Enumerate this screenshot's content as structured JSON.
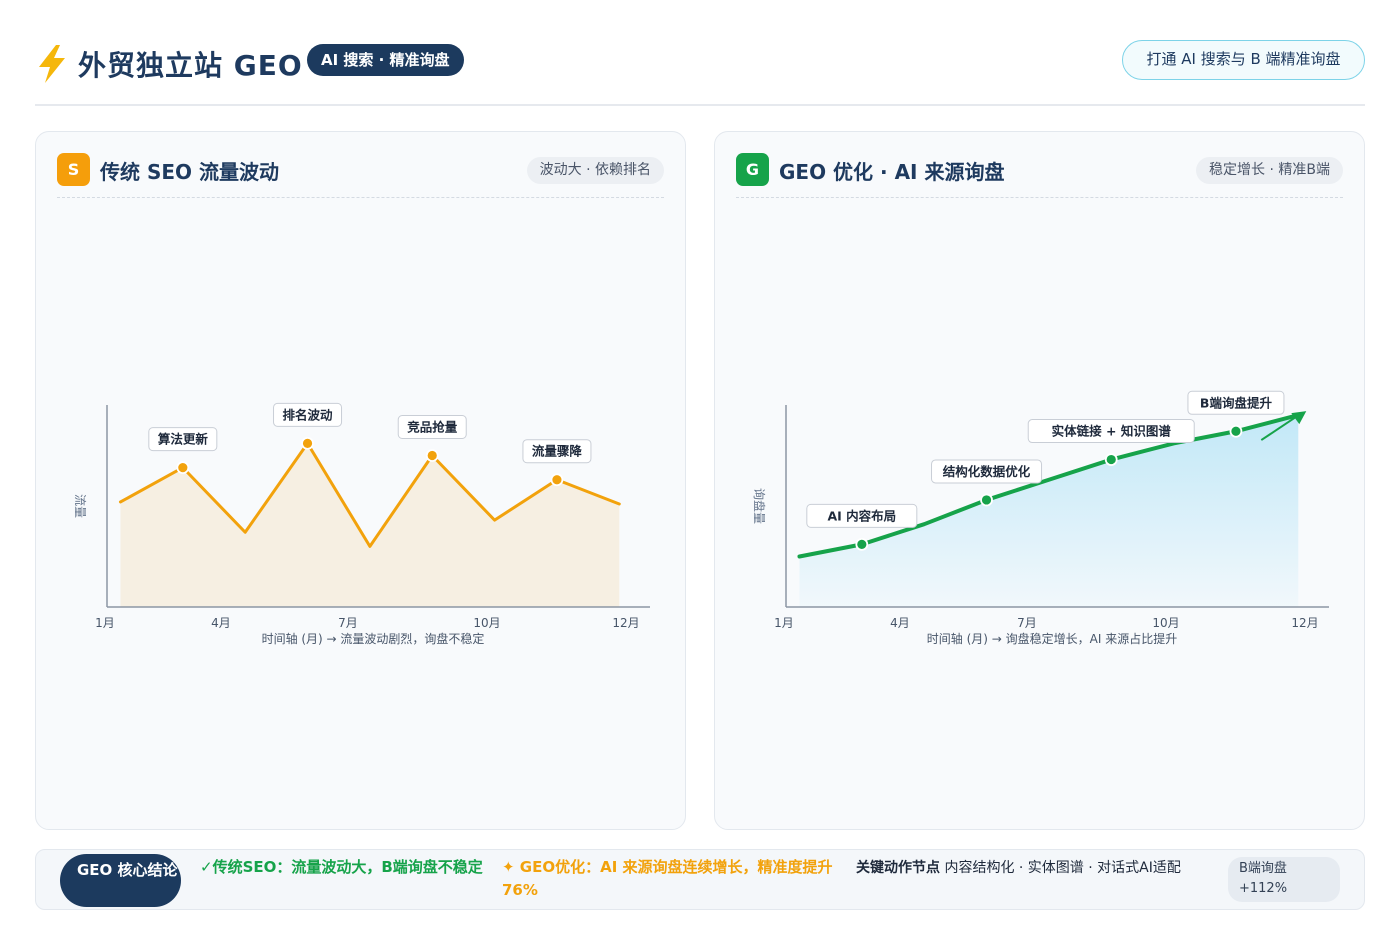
{
  "header": {
    "icon": "lightning-icon",
    "title": "外贸独立站 GEO",
    "badge": "AI 搜索 · 精准询盘",
    "cta": "打通 AI 搜索与 B 端精准询盘"
  },
  "panels": {
    "left": {
      "icon_letter": "S",
      "title": "传统 SEO 流量波动",
      "tag": "波动大 · 依赖排名",
      "color": "#f59e0b"
    },
    "right": {
      "icon_letter": "G",
      "title": "GEO 优化 · AI 来源询盘",
      "tag": "稳定增长 · 精准B端",
      "color": "#16a34a"
    }
  },
  "chart_data": [
    {
      "type": "area",
      "ylabel": "流量",
      "xlabel": "时间轴 (月) → 流量波动剧烈，询盘不稳定",
      "x_ticks": [
        "1月",
        "4月",
        "7月",
        "10月",
        "12月"
      ],
      "series": [
        {
          "x": [
            1,
            3,
            5,
            7,
            9,
            11,
            13,
            15,
            17
          ],
          "values": [
            0.52,
            0.69,
            0.37,
            0.81,
            0.3,
            0.75,
            0.43,
            0.63,
            0.51
          ]
        }
      ],
      "annotations": [
        {
          "x": 3,
          "y": 0.69,
          "text": "算法更新"
        },
        {
          "x": 7,
          "y": 0.81,
          "text": "排名波动"
        },
        {
          "x": 11,
          "y": 0.75,
          "text": "竞品抢量"
        },
        {
          "x": 15,
          "y": 0.63,
          "text": "流量骤降"
        }
      ],
      "xlim": [
        0.6,
        17.6
      ],
      "ylim": [
        0,
        1
      ],
      "grid": false,
      "color": "#f2a20c",
      "fill": "#f6efe2"
    },
    {
      "type": "area",
      "ylabel": "询盘量",
      "xlabel": "时间轴 (月) → 询盘稳定增长，AI 来源占比提升",
      "x_ticks": [
        "1月",
        "4月",
        "7月",
        "10月",
        "12月"
      ],
      "series": [
        {
          "x": [
            1,
            3,
            5,
            7,
            9,
            11,
            13,
            15,
            17
          ],
          "values": [
            0.25,
            0.31,
            0.41,
            0.53,
            0.63,
            0.73,
            0.81,
            0.87,
            0.95
          ]
        }
      ],
      "annotations": [
        {
          "x": 3,
          "y": 0.31,
          "text": "AI 内容布局"
        },
        {
          "x": 7,
          "y": 0.53,
          "text": "结构化数据优化"
        },
        {
          "x": 11,
          "y": 0.73,
          "text": "实体链接 + 知识图谱"
        },
        {
          "x": 15,
          "y": 0.87,
          "text": "B端询盘提升"
        }
      ],
      "xlim": [
        0.6,
        17.6
      ],
      "ylim": [
        0,
        1
      ],
      "grid": false,
      "color": "#16a34a",
      "fill": "#bfe7f7"
    }
  ],
  "footer": {
    "pill": "GEO 核心结论",
    "seo_text": "✓传统SEO：流量波动大，B端询盘不稳定",
    "geo_text": "✦ GEO优化：AI 来源询盘连续增长，精准度提升76%",
    "nodes_label": "关键动作节点",
    "nodes_text": "内容结构化 · 实体图谱 · 对话式AI适配",
    "stat_label": "B端询盘",
    "stat_value": "+112%"
  }
}
